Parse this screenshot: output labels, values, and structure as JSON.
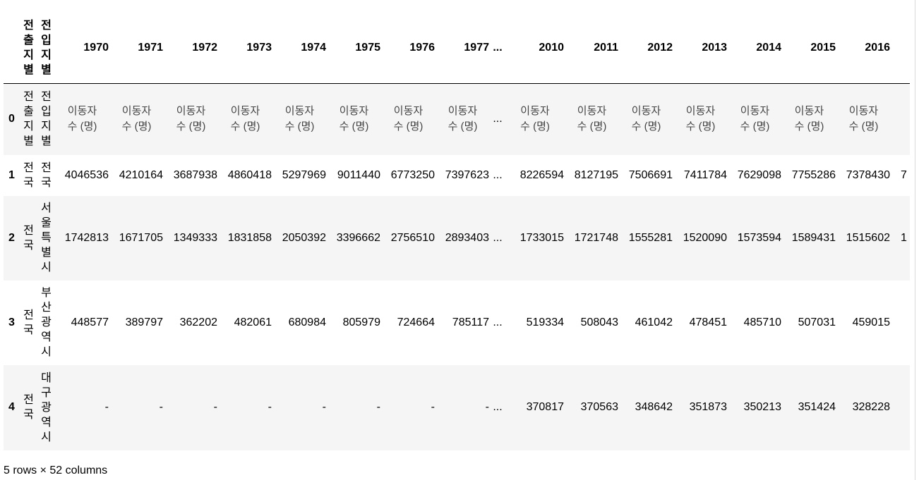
{
  "table": {
    "index_header": "",
    "col_a_header": "전출지별",
    "col_b_header": "전입지별",
    "year_headers_left": [
      "1970",
      "1971",
      "1972",
      "1973",
      "1974",
      "1975",
      "1976",
      "1977"
    ],
    "ellipsis": "...",
    "year_headers_right": [
      "2010",
      "2011",
      "2012",
      "2013",
      "2014",
      "2015",
      "2016"
    ],
    "rows": [
      {
        "index": "0",
        "col_a": "전출지별",
        "col_b": "전입지별",
        "left": [
          "이동자수 (명)",
          "이동자수 (명)",
          "이동자수 (명)",
          "이동자수 (명)",
          "이동자수 (명)",
          "이동자수 (명)",
          "이동자수 (명)",
          "이동자수 (명)"
        ],
        "ellipsis": "...",
        "right": [
          "이동자수 (명)",
          "이동자수 (명)",
          "이동자수 (명)",
          "이동자수 (명)",
          "이동자수 (명)",
          "이동자수 (명)",
          "이동자수 (명)"
        ]
      },
      {
        "index": "1",
        "col_a": "전국",
        "col_b": "전국",
        "left": [
          "4046536",
          "4210164",
          "3687938",
          "4860418",
          "5297969",
          "9011440",
          "6773250",
          "7397623"
        ],
        "ellipsis": "...",
        "right": [
          "8226594",
          "8127195",
          "7506691",
          "7411784",
          "7629098",
          "7755286",
          "7378430"
        ],
        "overflow": "7"
      },
      {
        "index": "2",
        "col_a": "전국",
        "col_b": "서울특별시",
        "left": [
          "1742813",
          "1671705",
          "1349333",
          "1831858",
          "2050392",
          "3396662",
          "2756510",
          "2893403"
        ],
        "ellipsis": "...",
        "right": [
          "1733015",
          "1721748",
          "1555281",
          "1520090",
          "1573594",
          "1589431",
          "1515602"
        ],
        "overflow": "1"
      },
      {
        "index": "3",
        "col_a": "전국",
        "col_b": "부산광역시",
        "left": [
          "448577",
          "389797",
          "362202",
          "482061",
          "680984",
          "805979",
          "724664",
          "785117"
        ],
        "ellipsis": "...",
        "right": [
          "519334",
          "508043",
          "461042",
          "478451",
          "485710",
          "507031",
          "459015"
        ]
      },
      {
        "index": "4",
        "col_a": "전국",
        "col_b": "대구광역시",
        "left": [
          "-",
          "-",
          "-",
          "-",
          "-",
          "-",
          "-",
          "-"
        ],
        "ellipsis": "...",
        "right": [
          "370817",
          "370563",
          "348642",
          "351873",
          "350213",
          "351424",
          "328228"
        ]
      }
    ]
  },
  "footer": {
    "shape": "5 rows × 52 columns"
  }
}
